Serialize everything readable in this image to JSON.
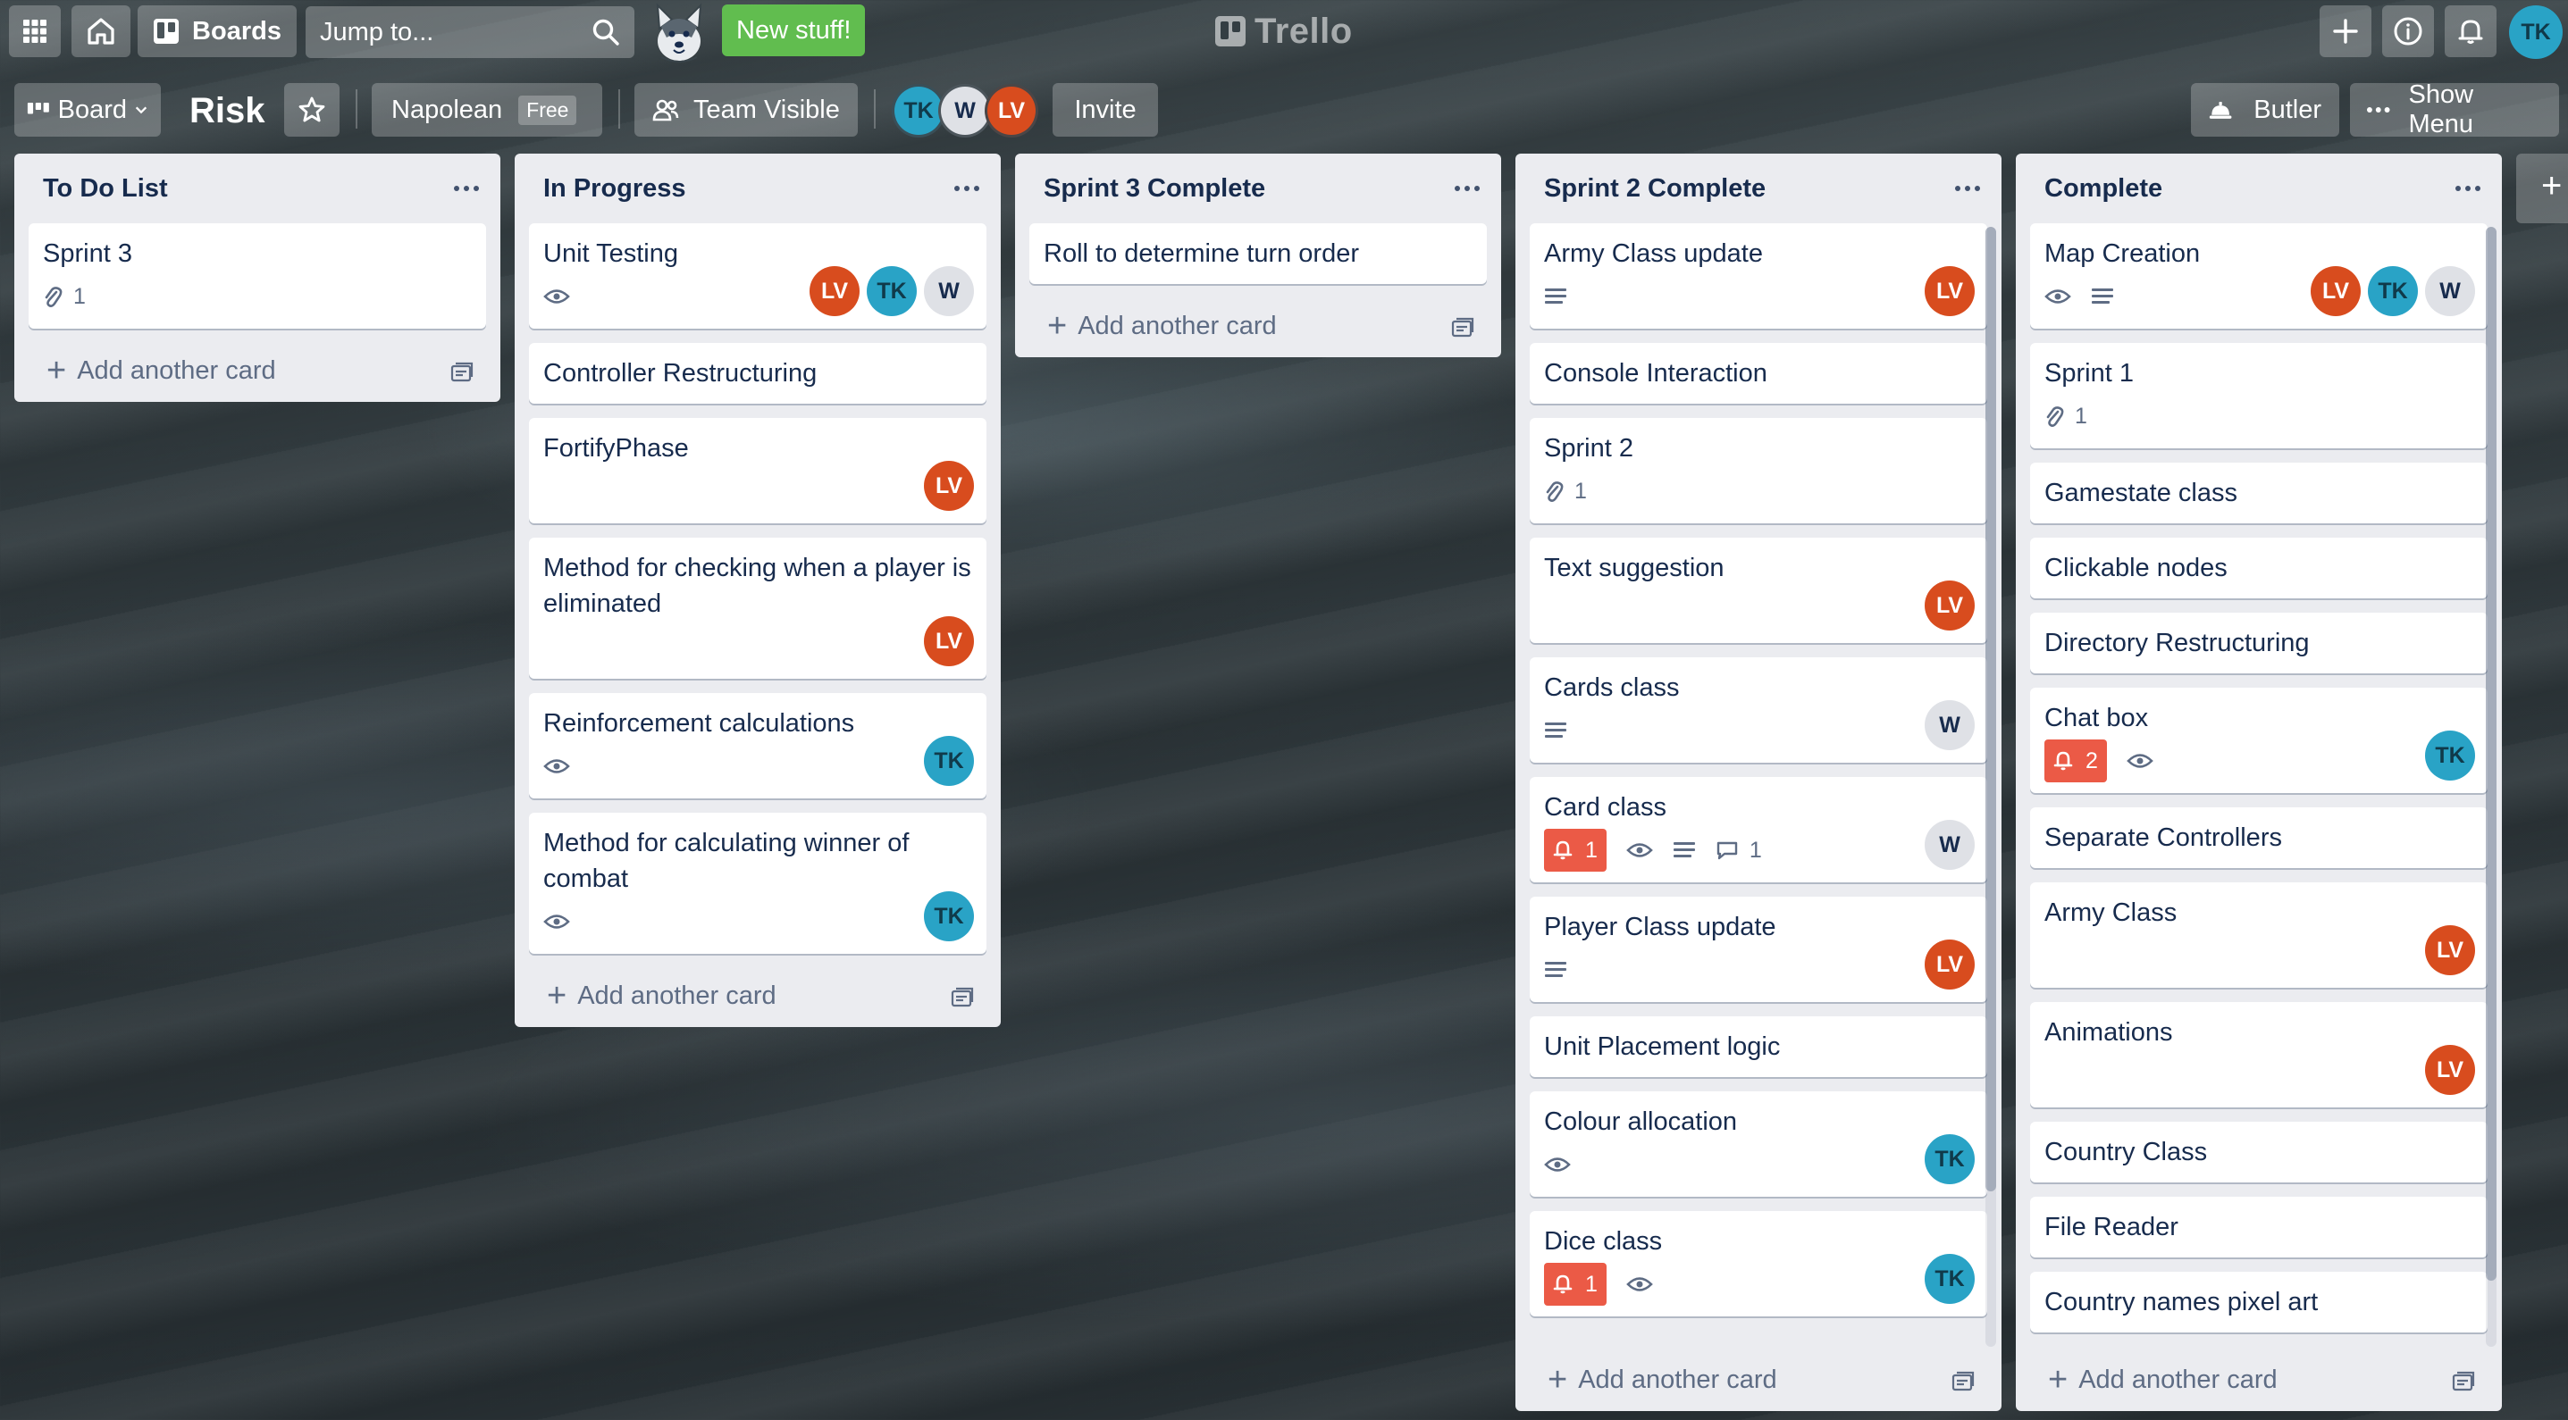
{
  "topbar": {
    "boards_label": "Boards",
    "jump_placeholder": "Jump to...",
    "new_stuff_label": "New stuff!",
    "logo_text": "Trello",
    "user_initials": "TK"
  },
  "board": {
    "view_label": "Board",
    "title": "Risk",
    "team_name": "Napolean",
    "team_plan": "Free",
    "visibility_label": "Team Visible",
    "members": [
      "TK",
      "W",
      "LV"
    ],
    "invite_label": "Invite",
    "butler_label": "Butler",
    "show_menu_label": "Show Menu"
  },
  "add_card_label": "Add another card",
  "colors": {
    "lv": "#d84c1e",
    "tk": "#29a3c6",
    "w": "#dfe1e6",
    "new_stuff": "#61bd4f",
    "due_badge": "#eb5a46"
  },
  "lists": [
    {
      "title": "To Do List",
      "cards": [
        {
          "title": "Sprint 3",
          "attachments": "1"
        }
      ]
    },
    {
      "title": "In Progress",
      "cards": [
        {
          "title": "Unit Testing",
          "members": [
            "LV",
            "TK",
            "W"
          ]
        },
        {
          "title": "Controller Restructuring"
        },
        {
          "title": "FortifyPhase",
          "members": [
            "LV"
          ]
        },
        {
          "title": "Method for checking when a player is eliminated",
          "members": [
            "LV"
          ]
        },
        {
          "title": "Reinforcement calculations",
          "members": [
            "TK"
          ]
        },
        {
          "title": "Method for calculating winner of combat",
          "members": [
            "TK"
          ]
        }
      ]
    },
    {
      "title": "Sprint 3 Complete",
      "cards": [
        {
          "title": "Roll to determine turn order"
        }
      ]
    },
    {
      "title": "Sprint 2 Complete",
      "cards": [
        {
          "title": "Army Class update",
          "members": [
            "LV"
          ]
        },
        {
          "title": "Console Interaction"
        },
        {
          "title": "Sprint 2",
          "attachments": "1"
        },
        {
          "title": "Text suggestion",
          "members": [
            "LV"
          ]
        },
        {
          "title": "Cards class",
          "members": [
            "W"
          ]
        },
        {
          "title": "Card class",
          "due": "1",
          "comments": "1",
          "members": [
            "W"
          ]
        },
        {
          "title": "Player Class update",
          "members": [
            "LV"
          ]
        },
        {
          "title": "Unit Placement logic"
        },
        {
          "title": "Colour allocation",
          "members": [
            "TK"
          ]
        },
        {
          "title": "Dice class",
          "due": "1",
          "members": [
            "TK"
          ]
        }
      ]
    },
    {
      "title": "Complete",
      "cards": [
        {
          "title": "Map Creation",
          "members": [
            "LV",
            "TK",
            "W"
          ]
        },
        {
          "title": "Sprint 1",
          "attachments": "1"
        },
        {
          "title": "Gamestate class"
        },
        {
          "title": "Clickable nodes"
        },
        {
          "title": "Directory Restructuring"
        },
        {
          "title": "Chat box",
          "due": "2",
          "members": [
            "TK"
          ]
        },
        {
          "title": "Separate Controllers"
        },
        {
          "title": "Army Class",
          "members": [
            "LV"
          ]
        },
        {
          "title": "Animations",
          "members": [
            "LV"
          ]
        },
        {
          "title": "Country Class"
        },
        {
          "title": "File Reader"
        },
        {
          "title": "Country names pixel art"
        }
      ]
    }
  ]
}
